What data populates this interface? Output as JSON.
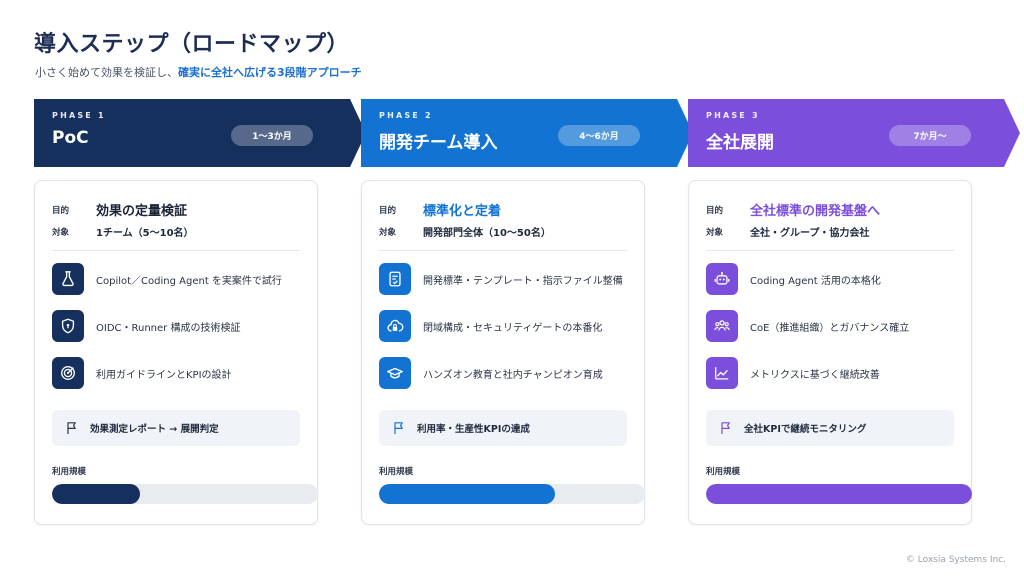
{
  "page": {
    "title": "導入ステップ（ロードマップ）",
    "subtitle_plain": "小さく始めて効果を検証し、",
    "subtitle_highlight": "確実に全社へ広げる3段階アプローチ",
    "footer": "© Loxsia Systems Inc."
  },
  "colors": {
    "phase1": "#16305e",
    "phase2": "#1373d3",
    "phase3": "#7b4fdc"
  },
  "phases": [
    {
      "label": "PHASE 1",
      "name": "PoC",
      "duration": "1〜3か月",
      "goal_label": "目的",
      "goal": "効果の定量検証",
      "target_label": "対象",
      "target": "1チーム（5〜10名）",
      "items": [
        {
          "icon": "flask-icon",
          "text": "Copilot／Coding Agent を実案件で試行"
        },
        {
          "icon": "shield-icon",
          "text": "OIDC・Runner 構成の技術検証"
        },
        {
          "icon": "target-icon",
          "text": "利用ガイドラインとKPIの設計"
        }
      ],
      "outcome_icon": "flag-icon",
      "outcome": "効果測定レポート → 展開判定",
      "usage_label": "利用規模",
      "usage": 0.33
    },
    {
      "label": "PHASE 2",
      "name": "開発チーム導入",
      "duration": "4〜6か月",
      "goal_label": "目的",
      "goal": "標準化と定着",
      "target_label": "対象",
      "target": "開発部門全体（10〜50名）",
      "items": [
        {
          "icon": "document-check-icon",
          "text": "開発標準・テンプレート・指示ファイル整備"
        },
        {
          "icon": "cloud-lock-icon",
          "text": "閉域構成・セキュリティゲートの本番化"
        },
        {
          "icon": "graduation-cap-icon",
          "text": "ハンズオン教育と社内チャンピオン育成"
        }
      ],
      "outcome_icon": "flag-icon",
      "outcome": "利用率・生産性KPIの達成",
      "usage_label": "利用規模",
      "usage": 0.66
    },
    {
      "label": "PHASE 3",
      "name": "全社展開",
      "duration": "7か月〜",
      "goal_label": "目的",
      "goal": "全社標準の開発基盤へ",
      "target_label": "対象",
      "target": "全社・グループ・協力会社",
      "items": [
        {
          "icon": "robot-icon",
          "text": "Coding Agent 活用の本格化"
        },
        {
          "icon": "people-icon",
          "text": "CoE（推進組織）とガバナンス確立"
        },
        {
          "icon": "trend-chart-icon",
          "text": "メトリクスに基づく継続改善"
        }
      ],
      "outcome_icon": "flag-icon",
      "outcome": "全社KPIで継続モニタリング",
      "usage_label": "利用規模",
      "usage": 1.0
    }
  ]
}
